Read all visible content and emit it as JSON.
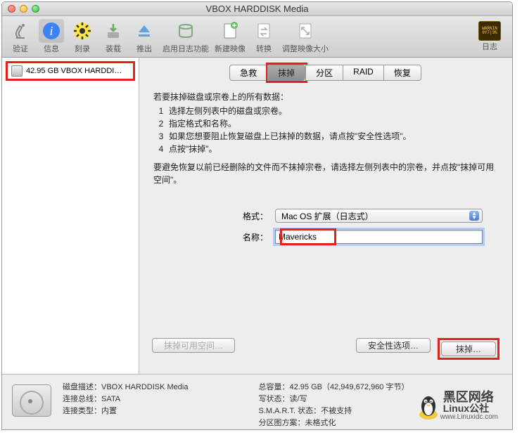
{
  "window": {
    "title": "VBOX HARDDISK Media"
  },
  "toolbar": {
    "items": [
      {
        "label": "验证"
      },
      {
        "label": "信息"
      },
      {
        "label": "刻录"
      },
      {
        "label": "装载"
      },
      {
        "label": "推出"
      },
      {
        "label": "启用日志功能"
      },
      {
        "label": "新建映像"
      },
      {
        "label": "转换"
      },
      {
        "label": "调整映像大小"
      }
    ],
    "right": {
      "label": "日志",
      "badge_top": "WARNIN",
      "badge_bot": "9Y7|3%"
    }
  },
  "sidebar": {
    "disk": "42.95 GB VBOX HARDDI…"
  },
  "tabs": [
    "急救",
    "抹掉",
    "分区",
    "RAID",
    "恢复"
  ],
  "active_tab": 1,
  "content": {
    "intro": "若要抹掉磁盘或宗卷上的所有数据：",
    "steps": [
      "选择左侧列表中的磁盘或宗卷。",
      "指定格式和名称。",
      "如果您想要阻止恢复磁盘上已抹掉的数据，请点按\"安全性选项\"。",
      "点按\"抹掉\"。"
    ],
    "warn": "要避免恢复以前已经删除的文件而不抹掉宗卷，请选择左侧列表中的宗卷，并点按\"抹掉可用空间\"。"
  },
  "form": {
    "format_label": "格式：",
    "format_value": "Mac OS 扩展（日志式）",
    "name_label": "名称：",
    "name_value": "Mavericks"
  },
  "buttons": {
    "erase_free": "抹掉可用空间…",
    "security": "安全性选项…",
    "erase": "抹掉…"
  },
  "footer": {
    "left": {
      "k1": "磁盘描述：",
      "v1": "VBOX HARDDISK Media",
      "k2": "连接总线：",
      "v2": "SATA",
      "k3": "连接类型：",
      "v3": "内置"
    },
    "right": {
      "k1": "总容量：",
      "v1": "42.95 GB（42,949,672,960 字节）",
      "k2": "写状态：",
      "v2": "读/写",
      "k3": "S.M.A.R.T. 状态：",
      "v3": "不被支持",
      "k4": "分区图方案：",
      "v4": "未格式化"
    }
  },
  "watermark": {
    "title": "黑区网络",
    "brand": "Linux公社",
    "url": "www.Linuxidc.com"
  }
}
